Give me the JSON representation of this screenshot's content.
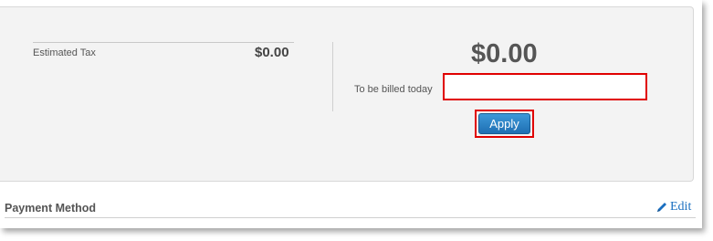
{
  "summary": {
    "tax_label": "Estimated Tax",
    "tax_value": "$0.00",
    "total_amount": "$0.00",
    "billed_today_label": "To be billed today",
    "billed_today_value": "",
    "apply_label": "Apply"
  },
  "payment_method": {
    "title": "Payment Method",
    "edit_label": "Edit",
    "edit_icon": "pencil-icon"
  },
  "colors": {
    "highlight": "#e00000",
    "button_blue": "#2a7fc4",
    "link_blue": "#1a6fc0"
  }
}
